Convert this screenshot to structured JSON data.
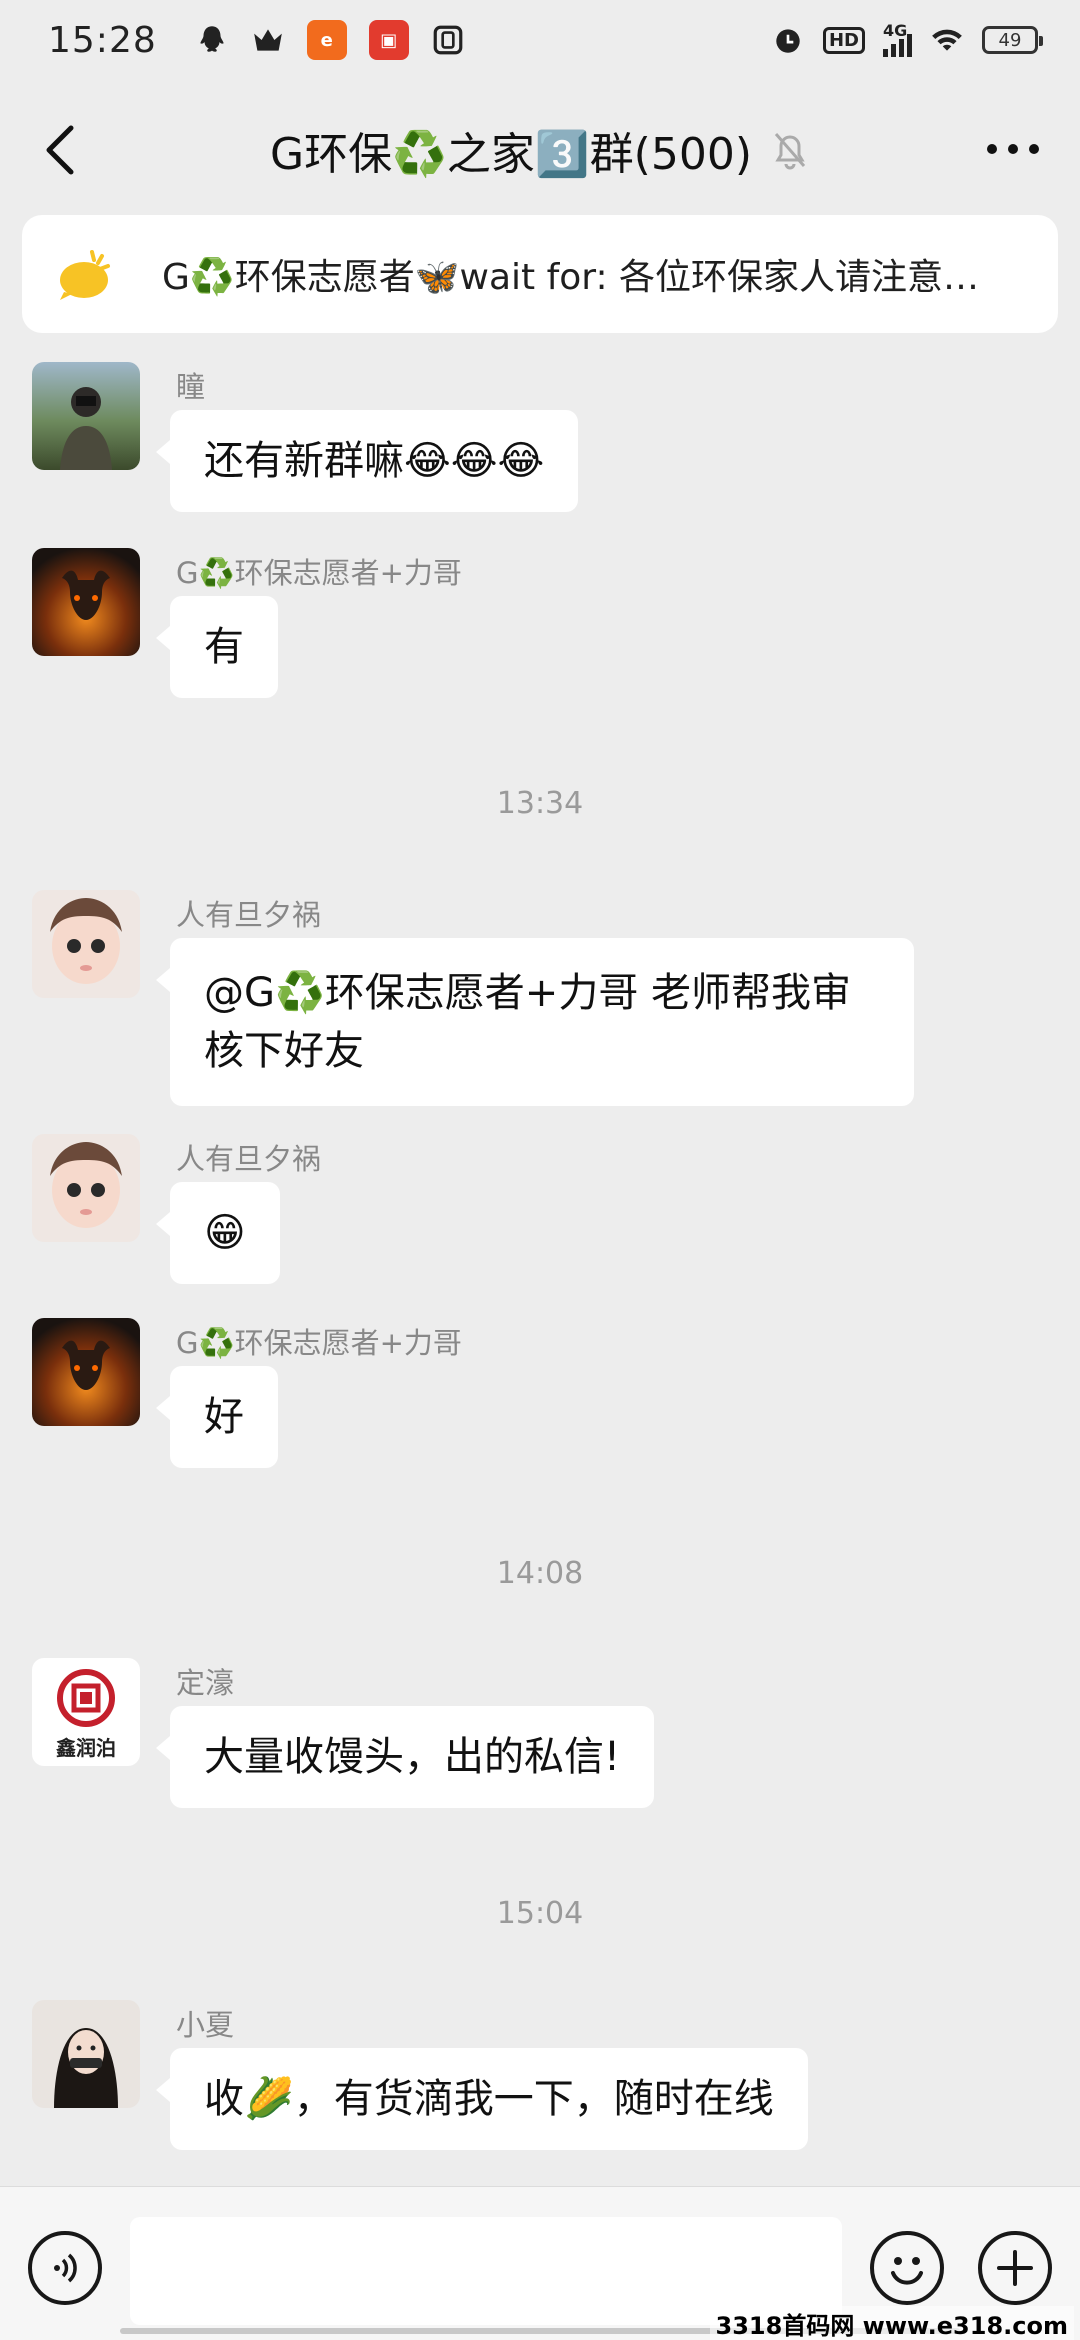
{
  "status_bar": {
    "time": "15:28",
    "app_icons": [
      "qq-icon",
      "crown-icon",
      "app-orange-icon",
      "app-red-icon",
      "app-box-icon"
    ],
    "network": "4G",
    "hd": "HD",
    "battery": "49"
  },
  "header": {
    "title": "G环保♻️之家3️⃣群(500)",
    "muted": true
  },
  "notice": {
    "text": "G♻️环保志愿者🦋wait for: 各位环保家人请注意…"
  },
  "messages": [
    {
      "sender": "瞳",
      "text": "还有新群嘛😂😂😂"
    },
    {
      "sender": "G♻️环保志愿者+力哥",
      "text": "有"
    },
    {
      "timestamp": "13:34"
    },
    {
      "sender": "人有旦夕祸",
      "text": "@G♻️环保志愿者+力哥 老师帮我审核下好友"
    },
    {
      "sender": "人有旦夕祸",
      "text": "😁"
    },
    {
      "sender": "G♻️环保志愿者+力哥",
      "text": "好"
    },
    {
      "timestamp": "14:08"
    },
    {
      "sender": "定濠",
      "text": "大量收馒头，出的私信!"
    },
    {
      "timestamp": "15:04"
    },
    {
      "sender": "小夏",
      "text": "收🌽，有货滴我一下，随时在线"
    }
  ],
  "avatars": {
    "m0": "鑫润泊"
  },
  "input": {
    "value": "",
    "placeholder": ""
  },
  "watermark": "3318首码网 www.e318.com",
  "colors": {
    "background": "#ededed",
    "bubble": "#ffffff",
    "sender": "#888888"
  }
}
